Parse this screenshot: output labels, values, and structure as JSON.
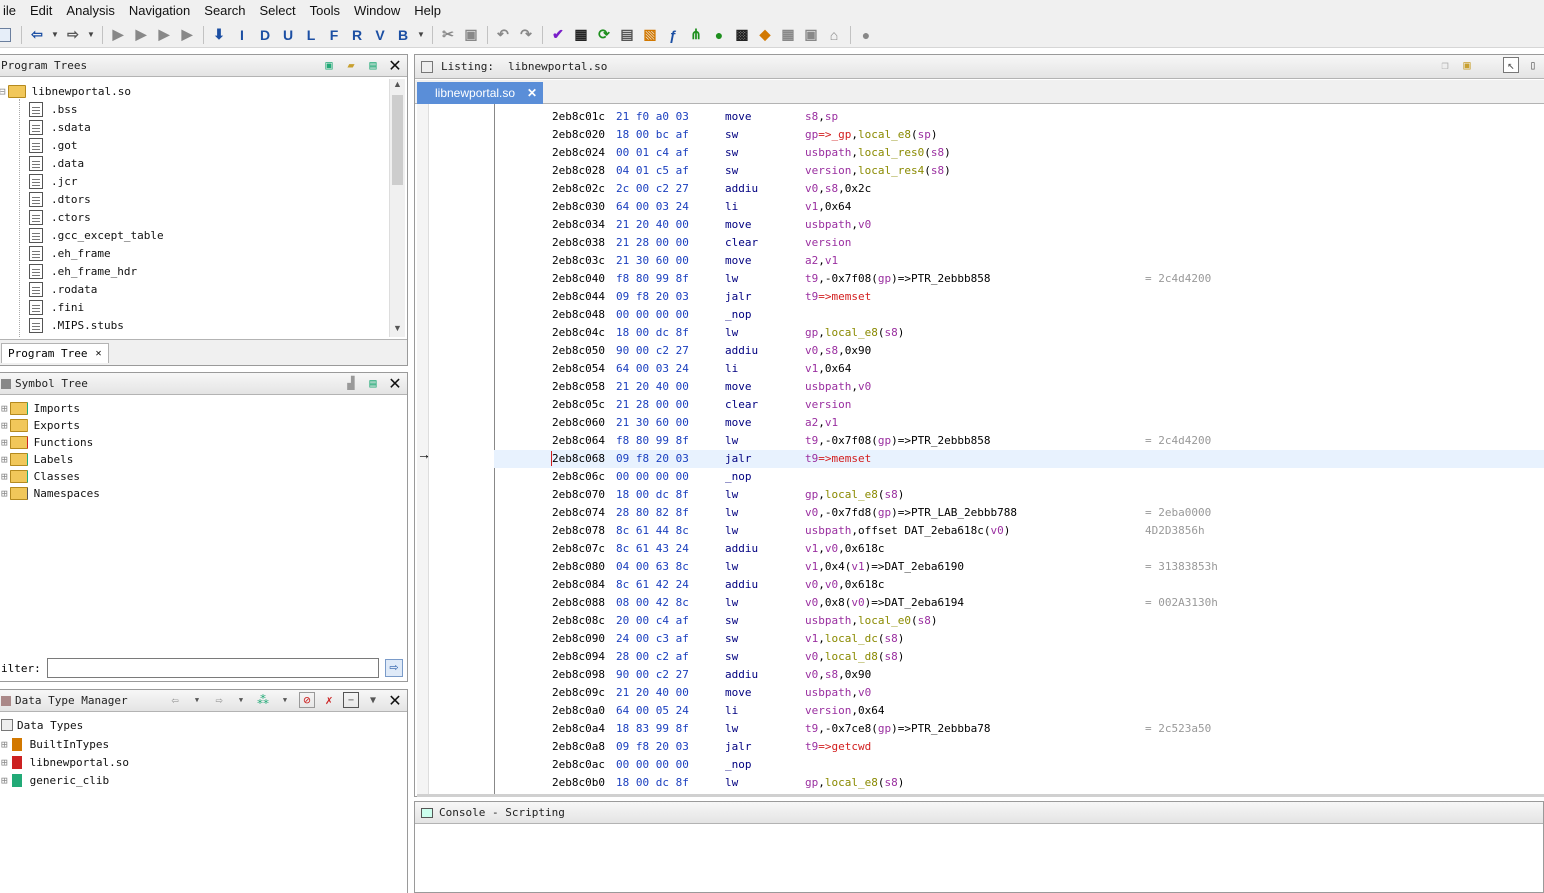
{
  "menu": [
    "ile",
    "Edit",
    "Analysis",
    "Navigation",
    "Search",
    "Select",
    "Tools",
    "Window",
    "Help"
  ],
  "toolbar": {
    "letters": [
      "I",
      "D",
      "U",
      "L",
      "F",
      "R",
      "V",
      "B"
    ]
  },
  "program_trees": {
    "title": "Program Trees",
    "root": "libnewportal.so",
    "items": [
      ".bss",
      ".sdata",
      ".got",
      ".data",
      ".jcr",
      ".dtors",
      ".ctors",
      ".gcc_except_table",
      ".eh_frame",
      ".eh_frame_hdr",
      ".rodata",
      ".fini",
      ".MIPS.stubs"
    ],
    "tab_label": "Program Tree"
  },
  "symbol_tree": {
    "title": "Symbol Tree",
    "items": [
      "Imports",
      "Exports",
      "Functions",
      "Labels",
      "Classes",
      "Namespaces"
    ],
    "filter_label": "ilter:",
    "filter_value": ""
  },
  "data_type_manager": {
    "title": "Data Type Manager",
    "root": "Data Types",
    "items": [
      "BuiltInTypes",
      "libnewportal.so",
      "generic_clib"
    ]
  },
  "listing": {
    "title": "Listing:",
    "program": "libnewportal.so",
    "tab_label": "libnewportal.so",
    "rows": [
      {
        "addr": "2eb8c01c",
        "bytes": "21 f0 a0 03",
        "mnem": "move",
        "ops": [
          [
            "s8",
            "reg"
          ],
          [
            ",",
            "plain"
          ],
          [
            "sp",
            "reg"
          ]
        ],
        "cmt": ""
      },
      {
        "addr": "2eb8c020",
        "bytes": "18 00 bc af",
        "mnem": "sw",
        "ops": [
          [
            "gp",
            "reg"
          ],
          [
            "=>",
            "red"
          ],
          [
            "_gp",
            "red"
          ],
          [
            ",",
            "plain"
          ],
          [
            "local_e8",
            "var"
          ],
          [
            "(",
            "plain"
          ],
          [
            "sp",
            "reg"
          ],
          [
            ")",
            "plain"
          ]
        ],
        "cmt": ""
      },
      {
        "addr": "2eb8c024",
        "bytes": "00 01 c4 af",
        "mnem": "sw",
        "ops": [
          [
            "usbpath",
            "reg"
          ],
          [
            ",",
            "plain"
          ],
          [
            "local_res0",
            "var"
          ],
          [
            "(",
            "plain"
          ],
          [
            "s8",
            "reg"
          ],
          [
            ")",
            "plain"
          ]
        ],
        "cmt": ""
      },
      {
        "addr": "2eb8c028",
        "bytes": "04 01 c5 af",
        "mnem": "sw",
        "ops": [
          [
            "version",
            "reg"
          ],
          [
            ",",
            "plain"
          ],
          [
            "local_res4",
            "var"
          ],
          [
            "(",
            "plain"
          ],
          [
            "s8",
            "reg"
          ],
          [
            ")",
            "plain"
          ]
        ],
        "cmt": ""
      },
      {
        "addr": "2eb8c02c",
        "bytes": "2c 00 c2 27",
        "mnem": "addiu",
        "ops": [
          [
            "v0",
            "reg"
          ],
          [
            ",",
            "plain"
          ],
          [
            "s8",
            "reg"
          ],
          [
            ",",
            "plain"
          ],
          [
            "0x2c",
            "plain"
          ]
        ],
        "cmt": ""
      },
      {
        "addr": "2eb8c030",
        "bytes": "64 00 03 24",
        "mnem": "li",
        "ops": [
          [
            "v1",
            "reg"
          ],
          [
            ",",
            "plain"
          ],
          [
            "0x64",
            "plain"
          ]
        ],
        "cmt": ""
      },
      {
        "addr": "2eb8c034",
        "bytes": "21 20 40 00",
        "mnem": "move",
        "ops": [
          [
            "usbpath",
            "reg"
          ],
          [
            ",",
            "plain"
          ],
          [
            "v0",
            "reg"
          ]
        ],
        "cmt": ""
      },
      {
        "addr": "2eb8c038",
        "bytes": "21 28 00 00",
        "mnem": "clear",
        "ops": [
          [
            "version",
            "reg"
          ]
        ],
        "cmt": ""
      },
      {
        "addr": "2eb8c03c",
        "bytes": "21 30 60 00",
        "mnem": "move",
        "ops": [
          [
            "a2",
            "reg"
          ],
          [
            ",",
            "plain"
          ],
          [
            "v1",
            "reg"
          ]
        ],
        "cmt": ""
      },
      {
        "addr": "2eb8c040",
        "bytes": "f8 80 99 8f",
        "mnem": "lw",
        "ops": [
          [
            "t9",
            "reg"
          ],
          [
            ",",
            "plain"
          ],
          [
            "-0x7f08",
            "plain"
          ],
          [
            "(",
            "plain"
          ],
          [
            "gp",
            "reg"
          ],
          [
            ")",
            "plain"
          ],
          [
            "=>",
            "plain"
          ],
          [
            "PTR_2ebbb858",
            "plain"
          ]
        ],
        "cmt": "= 2c4d4200"
      },
      {
        "addr": "2eb8c044",
        "bytes": "09 f8 20 03",
        "mnem": "jalr",
        "ops": [
          [
            "t9",
            "reg"
          ],
          [
            "=>",
            "red"
          ],
          [
            "memset",
            "red"
          ]
        ],
        "cmt": ""
      },
      {
        "addr": "2eb8c048",
        "bytes": "00 00 00 00",
        "mnem": "_nop",
        "ops": [],
        "cmt": ""
      },
      {
        "addr": "2eb8c04c",
        "bytes": "18 00 dc 8f",
        "mnem": "lw",
        "ops": [
          [
            "gp",
            "reg"
          ],
          [
            ",",
            "plain"
          ],
          [
            "local_e8",
            "var"
          ],
          [
            "(",
            "plain"
          ],
          [
            "s8",
            "reg"
          ],
          [
            ")",
            "plain"
          ]
        ],
        "cmt": ""
      },
      {
        "addr": "2eb8c050",
        "bytes": "90 00 c2 27",
        "mnem": "addiu",
        "ops": [
          [
            "v0",
            "reg"
          ],
          [
            ",",
            "plain"
          ],
          [
            "s8",
            "reg"
          ],
          [
            ",",
            "plain"
          ],
          [
            "0x90",
            "plain"
          ]
        ],
        "cmt": ""
      },
      {
        "addr": "2eb8c054",
        "bytes": "64 00 03 24",
        "mnem": "li",
        "ops": [
          [
            "v1",
            "reg"
          ],
          [
            ",",
            "plain"
          ],
          [
            "0x64",
            "plain"
          ]
        ],
        "cmt": ""
      },
      {
        "addr": "2eb8c058",
        "bytes": "21 20 40 00",
        "mnem": "move",
        "ops": [
          [
            "usbpath",
            "reg"
          ],
          [
            ",",
            "plain"
          ],
          [
            "v0",
            "reg"
          ]
        ],
        "cmt": ""
      },
      {
        "addr": "2eb8c05c",
        "bytes": "21 28 00 00",
        "mnem": "clear",
        "ops": [
          [
            "version",
            "reg"
          ]
        ],
        "cmt": ""
      },
      {
        "addr": "2eb8c060",
        "bytes": "21 30 60 00",
        "mnem": "move",
        "ops": [
          [
            "a2",
            "reg"
          ],
          [
            ",",
            "plain"
          ],
          [
            "v1",
            "reg"
          ]
        ],
        "cmt": ""
      },
      {
        "addr": "2eb8c064",
        "bytes": "f8 80 99 8f",
        "mnem": "lw",
        "ops": [
          [
            "t9",
            "reg"
          ],
          [
            ",",
            "plain"
          ],
          [
            "-0x7f08",
            "plain"
          ],
          [
            "(",
            "plain"
          ],
          [
            "gp",
            "reg"
          ],
          [
            ")",
            "plain"
          ],
          [
            "=>",
            "plain"
          ],
          [
            "PTR_2ebbb858",
            "plain"
          ]
        ],
        "cmt": "= 2c4d4200"
      },
      {
        "addr": "2eb8c068",
        "bytes": "09 f8 20 03",
        "mnem": "jalr",
        "ops": [
          [
            "t9",
            "reg"
          ],
          [
            "=>",
            "red"
          ],
          [
            "memset",
            "red"
          ]
        ],
        "cmt": "",
        "selected": true
      },
      {
        "addr": "2eb8c06c",
        "bytes": "00 00 00 00",
        "mnem": "_nop",
        "ops": [],
        "cmt": ""
      },
      {
        "addr": "2eb8c070",
        "bytes": "18 00 dc 8f",
        "mnem": "lw",
        "ops": [
          [
            "gp",
            "reg"
          ],
          [
            ",",
            "plain"
          ],
          [
            "local_e8",
            "var"
          ],
          [
            "(",
            "plain"
          ],
          [
            "s8",
            "reg"
          ],
          [
            ")",
            "plain"
          ]
        ],
        "cmt": ""
      },
      {
        "addr": "2eb8c074",
        "bytes": "28 80 82 8f",
        "mnem": "lw",
        "ops": [
          [
            "v0",
            "reg"
          ],
          [
            ",",
            "plain"
          ],
          [
            "-0x7fd8",
            "plain"
          ],
          [
            "(",
            "plain"
          ],
          [
            "gp",
            "reg"
          ],
          [
            ")",
            "plain"
          ],
          [
            "=>",
            "plain"
          ],
          [
            "PTR_LAB_2ebbb788",
            "plain"
          ]
        ],
        "cmt": "= 2eba0000"
      },
      {
        "addr": "2eb8c078",
        "bytes": "8c 61 44 8c",
        "mnem": "lw",
        "ops": [
          [
            "usbpath",
            "reg"
          ],
          [
            ",",
            "plain"
          ],
          [
            "offset DAT_2eba618c",
            "plain"
          ],
          [
            "(",
            "plain"
          ],
          [
            "v0",
            "reg"
          ],
          [
            ")",
            "plain"
          ]
        ],
        "cmt": "4D2D3856h"
      },
      {
        "addr": "2eb8c07c",
        "bytes": "8c 61 43 24",
        "mnem": "addiu",
        "ops": [
          [
            "v1",
            "reg"
          ],
          [
            ",",
            "plain"
          ],
          [
            "v0",
            "reg"
          ],
          [
            ",",
            "plain"
          ],
          [
            "0x618c",
            "plain"
          ]
        ],
        "cmt": ""
      },
      {
        "addr": "2eb8c080",
        "bytes": "04 00 63 8c",
        "mnem": "lw",
        "ops": [
          [
            "v1",
            "reg"
          ],
          [
            ",",
            "plain"
          ],
          [
            "0x4",
            "plain"
          ],
          [
            "(",
            "plain"
          ],
          [
            "v1",
            "reg"
          ],
          [
            ")",
            "plain"
          ],
          [
            "=>",
            "plain"
          ],
          [
            "DAT_2eba6190",
            "plain"
          ]
        ],
        "cmt": "= 31383853h"
      },
      {
        "addr": "2eb8c084",
        "bytes": "8c 61 42 24",
        "mnem": "addiu",
        "ops": [
          [
            "v0",
            "reg"
          ],
          [
            ",",
            "plain"
          ],
          [
            "v0",
            "reg"
          ],
          [
            ",",
            "plain"
          ],
          [
            "0x618c",
            "plain"
          ]
        ],
        "cmt": ""
      },
      {
        "addr": "2eb8c088",
        "bytes": "08 00 42 8c",
        "mnem": "lw",
        "ops": [
          [
            "v0",
            "reg"
          ],
          [
            ",",
            "plain"
          ],
          [
            "0x8",
            "plain"
          ],
          [
            "(",
            "plain"
          ],
          [
            "v0",
            "reg"
          ],
          [
            ")",
            "plain"
          ],
          [
            "=>",
            "plain"
          ],
          [
            "DAT_2eba6194",
            "plain"
          ]
        ],
        "cmt": "= 002A3130h"
      },
      {
        "addr": "2eb8c08c",
        "bytes": "20 00 c4 af",
        "mnem": "sw",
        "ops": [
          [
            "usbpath",
            "reg"
          ],
          [
            ",",
            "plain"
          ],
          [
            "local_e0",
            "var"
          ],
          [
            "(",
            "plain"
          ],
          [
            "s8",
            "reg"
          ],
          [
            ")",
            "plain"
          ]
        ],
        "cmt": ""
      },
      {
        "addr": "2eb8c090",
        "bytes": "24 00 c3 af",
        "mnem": "sw",
        "ops": [
          [
            "v1",
            "reg"
          ],
          [
            ",",
            "plain"
          ],
          [
            "local_dc",
            "var"
          ],
          [
            "(",
            "plain"
          ],
          [
            "s8",
            "reg"
          ],
          [
            ")",
            "plain"
          ]
        ],
        "cmt": ""
      },
      {
        "addr": "2eb8c094",
        "bytes": "28 00 c2 af",
        "mnem": "sw",
        "ops": [
          [
            "v0",
            "reg"
          ],
          [
            ",",
            "plain"
          ],
          [
            "local_d8",
            "var"
          ],
          [
            "(",
            "plain"
          ],
          [
            "s8",
            "reg"
          ],
          [
            ")",
            "plain"
          ]
        ],
        "cmt": ""
      },
      {
        "addr": "2eb8c098",
        "bytes": "90 00 c2 27",
        "mnem": "addiu",
        "ops": [
          [
            "v0",
            "reg"
          ],
          [
            ",",
            "plain"
          ],
          [
            "s8",
            "reg"
          ],
          [
            ",",
            "plain"
          ],
          [
            "0x90",
            "plain"
          ]
        ],
        "cmt": ""
      },
      {
        "addr": "2eb8c09c",
        "bytes": "21 20 40 00",
        "mnem": "move",
        "ops": [
          [
            "usbpath",
            "reg"
          ],
          [
            ",",
            "plain"
          ],
          [
            "v0",
            "reg"
          ]
        ],
        "cmt": ""
      },
      {
        "addr": "2eb8c0a0",
        "bytes": "64 00 05 24",
        "mnem": "li",
        "ops": [
          [
            "version",
            "reg"
          ],
          [
            ",",
            "plain"
          ],
          [
            "0x64",
            "plain"
          ]
        ],
        "cmt": ""
      },
      {
        "addr": "2eb8c0a4",
        "bytes": "18 83 99 8f",
        "mnem": "lw",
        "ops": [
          [
            "t9",
            "reg"
          ],
          [
            ",",
            "plain"
          ],
          [
            "-0x7ce8",
            "plain"
          ],
          [
            "(",
            "plain"
          ],
          [
            "gp",
            "reg"
          ],
          [
            ")",
            "plain"
          ],
          [
            "=>",
            "plain"
          ],
          [
            "PTR_2ebbba78",
            "plain"
          ]
        ],
        "cmt": "= 2c523a50"
      },
      {
        "addr": "2eb8c0a8",
        "bytes": "09 f8 20 03",
        "mnem": "jalr",
        "ops": [
          [
            "t9",
            "reg"
          ],
          [
            "=>",
            "red"
          ],
          [
            "getcwd",
            "red"
          ]
        ],
        "cmt": ""
      },
      {
        "addr": "2eb8c0ac",
        "bytes": "00 00 00 00",
        "mnem": "_nop",
        "ops": [],
        "cmt": ""
      },
      {
        "addr": "2eb8c0b0",
        "bytes": "18 00 dc 8f",
        "mnem": "lw",
        "ops": [
          [
            "gp",
            "reg"
          ],
          [
            ",",
            "plain"
          ],
          [
            "local_e8",
            "var"
          ],
          [
            "(",
            "plain"
          ],
          [
            "s8",
            "reg"
          ],
          [
            ")",
            "plain"
          ]
        ],
        "cmt": ""
      }
    ]
  },
  "console": {
    "title": "Console - Scripting"
  },
  "colors": {
    "register": "#9a2fa0",
    "variable": "#8a8a00",
    "call_target": "#d21e1e",
    "bytes": "#1a3fbf",
    "selection": "#e8f2fe"
  }
}
